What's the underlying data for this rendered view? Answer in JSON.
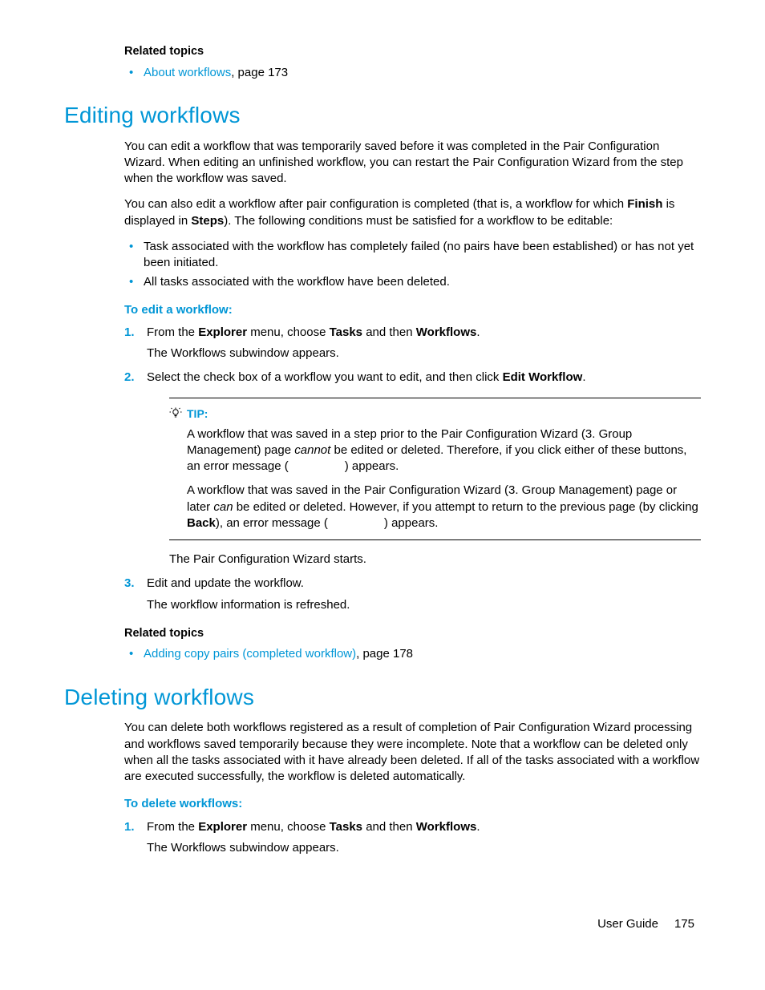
{
  "top_related": {
    "heading": "Related topics",
    "item_link": "About workflows",
    "item_tail": ", page 173"
  },
  "editing": {
    "heading": "Editing workflows",
    "p1": "You can edit a workflow that was temporarily saved before it was completed in the Pair Configuration Wizard. When editing an unfinished workflow,  you can restart the Pair Configuration Wizard from the step when the workflow was saved.",
    "p2_a": "You can also edit a workflow after pair configuration is completed (that is, a workflow for which ",
    "p2_b": "Finish",
    "p2_c": " is displayed in ",
    "p2_d": "Steps",
    "p2_e": ").  The following conditions must be satisfied for a workflow to be editable:",
    "cond1": "Task associated with the workflow has completely failed (no pairs have been established) or has not yet been initiated.",
    "cond2": "All tasks associated with the workflow have been deleted.",
    "proc_heading": "To edit a workflow:",
    "s1_a": "From the ",
    "s1_b": "Explorer",
    "s1_c": " menu, choose ",
    "s1_d": "Tasks",
    "s1_e": " and then ",
    "s1_f": "Workflows",
    "s1_g": ".",
    "s1_sub": "The Workflows subwindow appears.",
    "s2_a": "Select the check box of a workflow you want to edit, and then click ",
    "s2_b": "Edit Workflow",
    "s2_c": ".",
    "tip_label": "TIP:",
    "tip_p1_a": "A workflow that was saved in a step prior to the Pair Configuration Wizard (3. Group Management) page ",
    "tip_p1_b": "cannot",
    "tip_p1_c": " be edited or deleted. Therefore, if you click either of these buttons, an error message (",
    "tip_p1_d": ") appears.",
    "tip_p2_a": "A workflow that was saved in the Pair Configuration Wizard (3. Group Management) page or later ",
    "tip_p2_b": "can",
    "tip_p2_c": " be edited or deleted. However, if you attempt to return to the previous page (by clicking ",
    "tip_p2_d": "Back",
    "tip_p2_e": "), an error message (",
    "tip_p2_f": ") appears.",
    "after_tip": "The Pair Configuration Wizard starts.",
    "s3_a": "Edit and update the workflow.",
    "s3_sub": "The workflow information is refreshed.",
    "rel_heading": "Related topics",
    "rel_link": "Adding copy pairs (completed workflow)",
    "rel_tail": ", page 178"
  },
  "deleting": {
    "heading": "Deleting workflows",
    "p1": "You can delete both workflows registered as a result of completion of Pair Configuration Wizard processing and workflows saved temporarily because they were incomplete. Note that a workflow can be deleted only when all the tasks associated with it have already been deleted. If all of the tasks associated with a workflow are executed successfully, the workflow is deleted automatically.",
    "proc_heading": "To delete workflows:",
    "s1_a": "From the ",
    "s1_b": "Explorer",
    "s1_c": " menu, choose ",
    "s1_d": "Tasks",
    "s1_e": " and then ",
    "s1_f": "Workflows",
    "s1_g": ".",
    "s1_sub": "The Workflows subwindow appears."
  },
  "footer": {
    "label": "User Guide",
    "page": "175"
  }
}
